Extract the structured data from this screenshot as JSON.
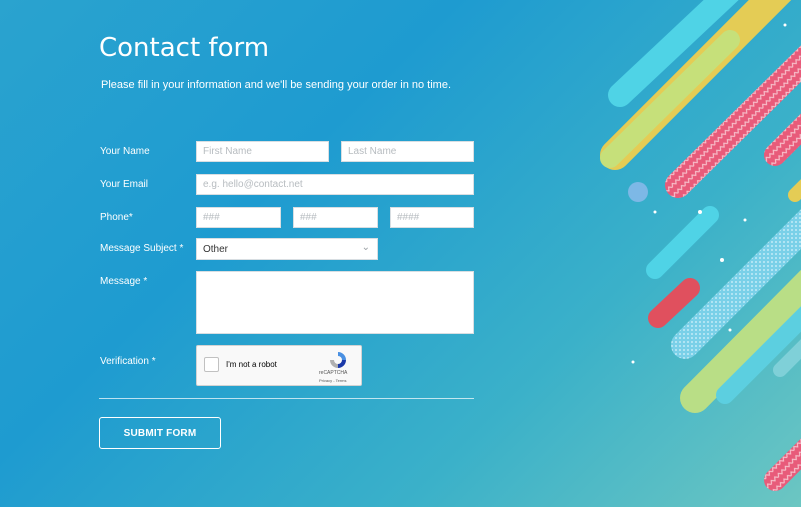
{
  "header": {
    "title": "Contact form",
    "subtitle": "Please fill in your information and we'll be sending your order in no time."
  },
  "fields": {
    "name": {
      "label": "Your Name",
      "first_placeholder": "First Name",
      "last_placeholder": "Last Name"
    },
    "email": {
      "label": "Your Email",
      "placeholder": "e.g. hello@contact.net"
    },
    "phone": {
      "label": "Phone*",
      "area_placeholder": "###",
      "prefix_placeholder": "###",
      "line_placeholder": "####"
    },
    "subject": {
      "label": "Message Subject *",
      "selected": "Other",
      "chevron_icon": "chevron-down-icon"
    },
    "message": {
      "label": "Message *",
      "value": ""
    },
    "verification": {
      "label": "Verification *",
      "checkbox_text": "I'm not a robot",
      "brand": "reCAPTCHA",
      "legal": "Privacy - Terms",
      "logo_icon": "recaptcha-logo-icon"
    }
  },
  "submit": {
    "label": "SUBMIT FORM"
  },
  "colors": {
    "accent_pink": "#e85b7a",
    "accent_yellow": "#e7cf5a",
    "accent_cyan": "#4fd1e8",
    "accent_green": "#c9e47a",
    "accent_red": "#e0505e"
  }
}
